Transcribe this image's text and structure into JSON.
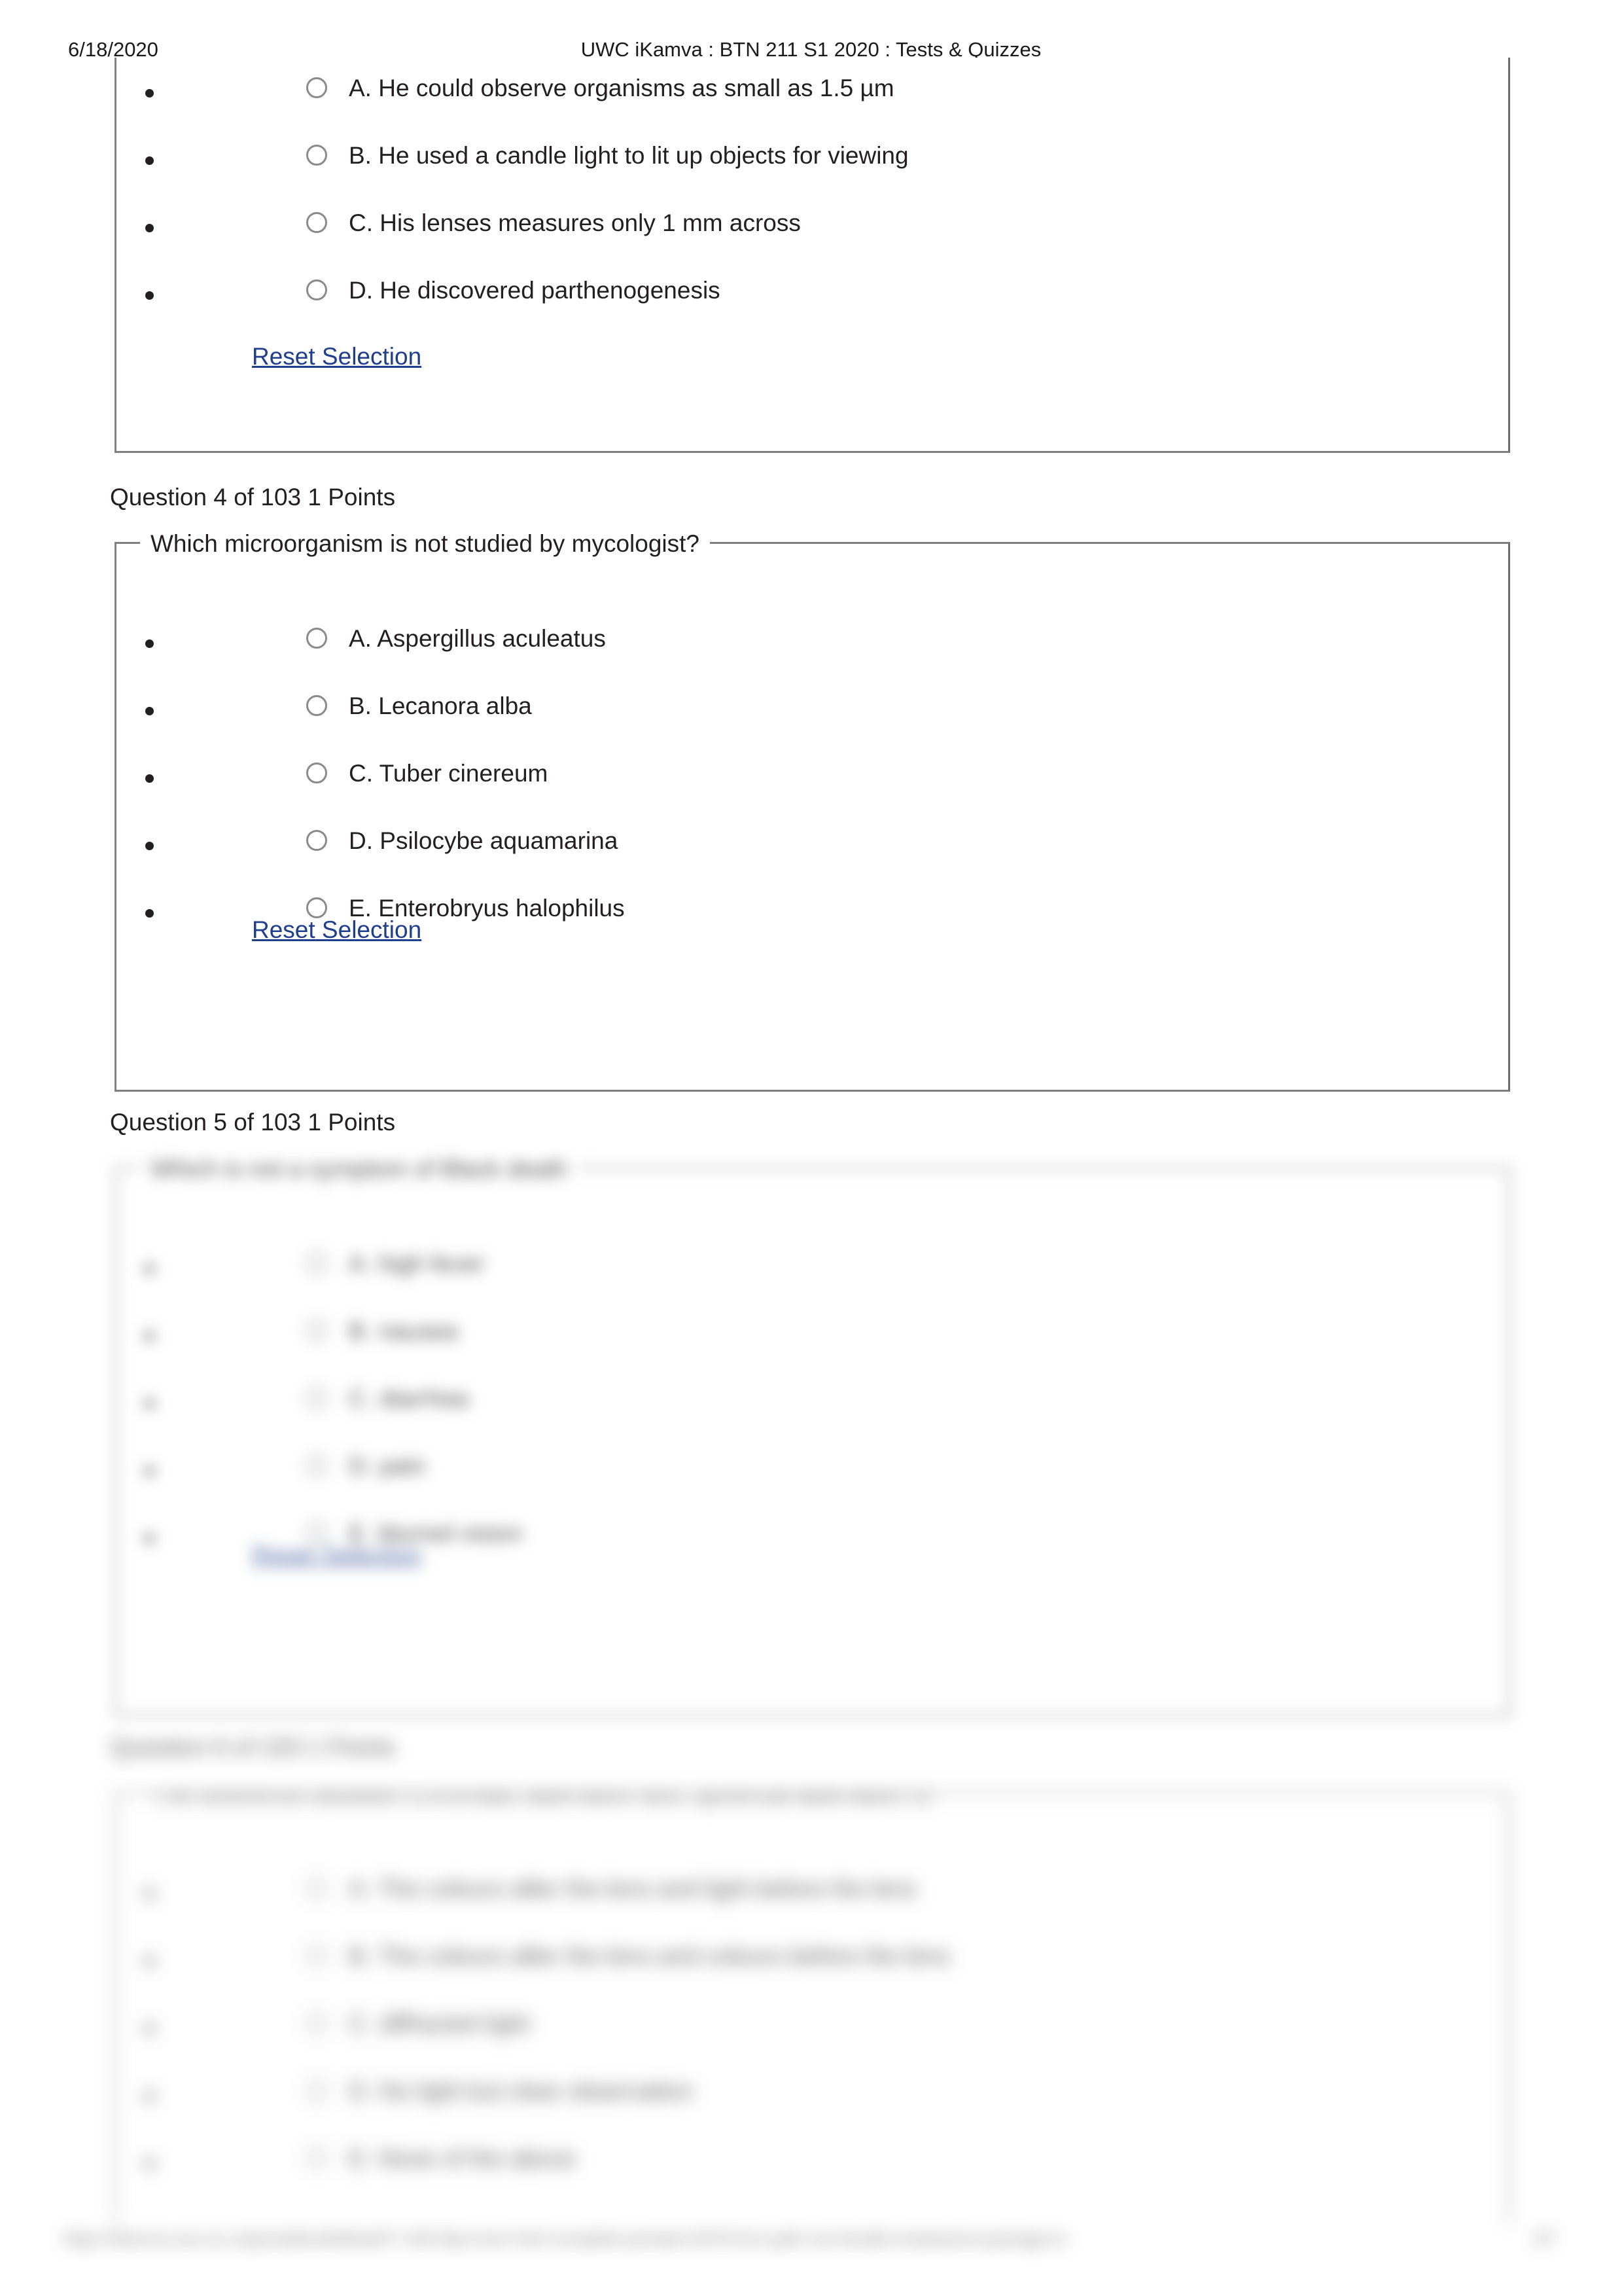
{
  "header": {
    "date": "6/18/2020",
    "title": "UWC iKamva : BTN 211 S1 2020 : Tests & Quizzes"
  },
  "common": {
    "reset_label": "Reset Selection"
  },
  "questions": [
    {
      "meta": "",
      "legend": "",
      "blurred": false,
      "options": [
        {
          "label": "A. He could observe organisms as small as 1.5 µm"
        },
        {
          "label": "B. He used a candle light to lit up objects for viewing"
        },
        {
          "label": "C. His lenses measures only 1 mm across"
        },
        {
          "label": "D. He discovered parthenogenesis"
        }
      ],
      "reset_label": "Reset Selection"
    },
    {
      "meta": "Question 4 of 103 1 Points",
      "legend": "Which microorganism is not studied by mycologist?",
      "blurred": false,
      "options": [
        {
          "label": "A. Aspergillus aculeatus"
        },
        {
          "label": "B. Lecanora alba"
        },
        {
          "label": "C. Tuber cinereum"
        },
        {
          "label": "D. Psilocybe aquamarina"
        },
        {
          "label": "E. Enterobryus halophilus"
        }
      ],
      "reset_label": "Reset Selection"
    },
    {
      "meta": "Question 5 of 103 1 Points",
      "legend": "Which is not a symptom of Black death",
      "blurred": true,
      "options": [
        {
          "label": "A. high fever"
        },
        {
          "label": "B. nausea"
        },
        {
          "label": "C. diarrhea"
        },
        {
          "label": "D. pain"
        },
        {
          "label": "E. blurred vision"
        }
      ],
      "reset_label": "Reset Selection"
    },
    {
      "meta": "Question 6 of 103 1 Points",
      "legend": "The difference between Chromatic aberration and Spherical aberration is",
      "blurred": true,
      "options": [
        {
          "label": "A. The colours after the lens and light before the lens"
        },
        {
          "label": "B. The colours after the lens and colours before the lens"
        },
        {
          "label": "C. diffracted light"
        },
        {
          "label": "D. No light but clear observation"
        },
        {
          "label": "E. None of the above"
        }
      ],
      "reset_label": ""
    }
  ],
  "footer": {
    "url": "https://ikamva.uwc.ac.za/portal/tool/default/7-148-http-inner-html-complete-pendant-8476-linn-path-not-handle-emphasize-package-to",
    "page": "3/7"
  }
}
